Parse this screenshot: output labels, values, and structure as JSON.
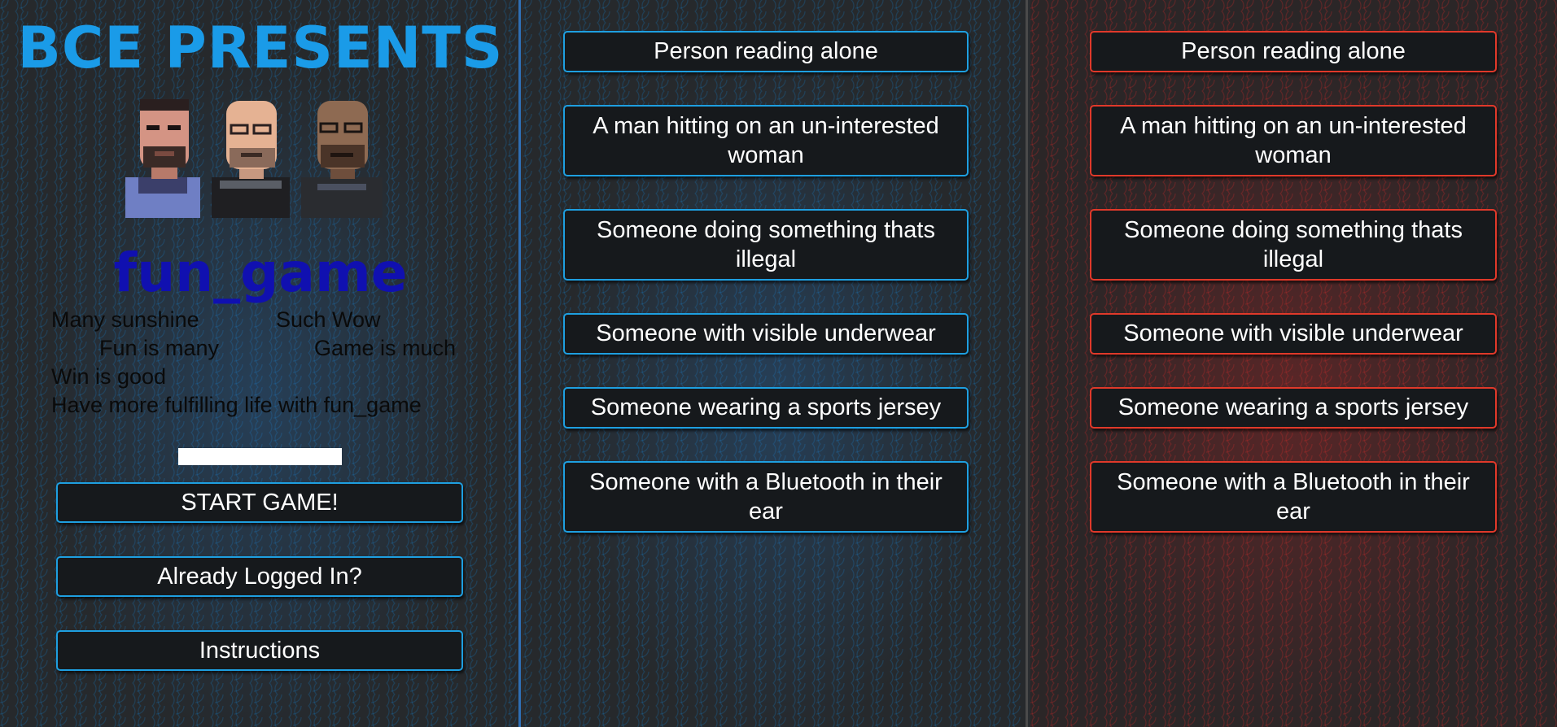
{
  "header": {
    "title": "BCE PRESENTS"
  },
  "game": {
    "name": "fun_game",
    "taglines": {
      "line1a": "Many sunshine",
      "line1b": "Such Wow",
      "line2a": "Fun is many",
      "line2b": "Game is much",
      "line3": "Win is good",
      "line4": "Have more fulfilling life with fun_game"
    }
  },
  "menu": {
    "start_label": "START GAME!",
    "login_label": "Already Logged In?",
    "instructions_label": "Instructions"
  },
  "cards_blue": [
    "Person reading alone",
    "A man hitting on an un-interested woman",
    "Someone doing something thats illegal",
    "Someone with visible underwear",
    "Someone wearing a sports jersey",
    "Someone with a Bluetooth in their ear"
  ],
  "cards_red": [
    "Person reading alone",
    "A man hitting on an un-interested woman",
    "Someone doing something thats illegal",
    "Someone with visible underwear",
    "Someone wearing a sports jersey",
    "Someone with a Bluetooth in their ear"
  ],
  "colors": {
    "title_blue": "#1a9be8",
    "game_name_blue": "#1010b0",
    "blue_border": "#1e9fe0",
    "red_border": "#e0392a"
  }
}
